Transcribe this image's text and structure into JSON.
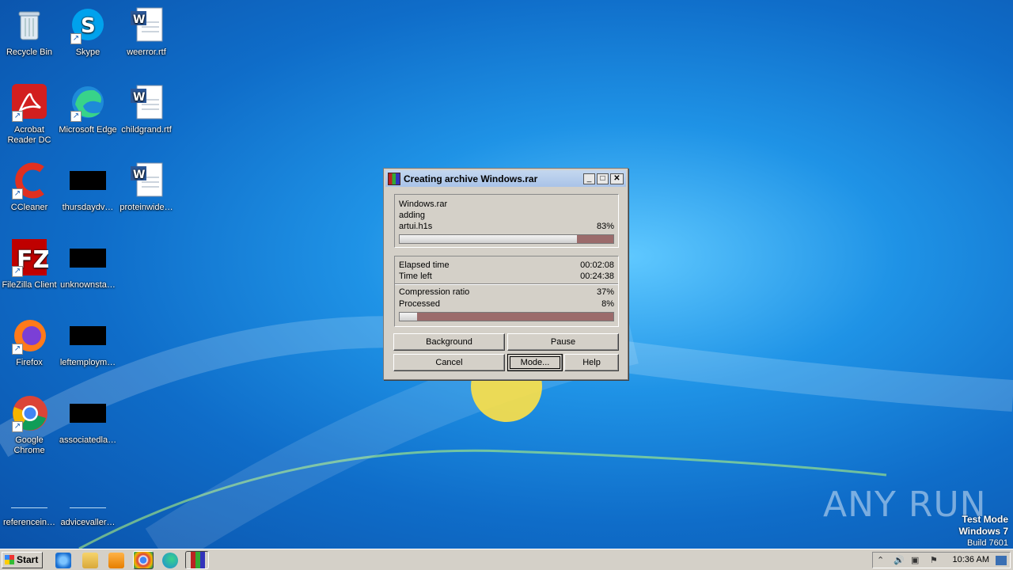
{
  "desktop": {
    "icons": [
      {
        "label": "Recycle Bin"
      },
      {
        "label": "Skype"
      },
      {
        "label": "weerror.rtf"
      },
      {
        "label": "Acrobat Reader DC"
      },
      {
        "label": "Microsoft Edge"
      },
      {
        "label": "childgrand.rtf"
      },
      {
        "label": "CCleaner"
      },
      {
        "label": "thursdaydv…"
      },
      {
        "label": "proteinwide…"
      },
      {
        "label": "FileZilla Client"
      },
      {
        "label": "unknownsta…"
      },
      {
        "label": "Firefox"
      },
      {
        "label": "leftemploym…"
      },
      {
        "label": "Google Chrome"
      },
      {
        "label": "associatedla…"
      },
      {
        "label": "referencein…"
      },
      {
        "label": "advicevaller…"
      }
    ]
  },
  "dialog": {
    "title": "Creating archive Windows.rar",
    "archive_name": "Windows.rar",
    "action": "adding",
    "current_file": "artui.h1s",
    "file_percent": "83%",
    "file_progress": 0.83,
    "elapsed_label": "Elapsed time",
    "elapsed_value": "00:02:08",
    "time_left_label": "Time left",
    "time_left_value": "00:24:38",
    "compression_label": "Compression ratio",
    "compression_value": "37%",
    "processed_label": "Processed",
    "processed_value": "8%",
    "processed_progress": 0.08,
    "buttons": {
      "background": "Background",
      "pause": "Pause",
      "cancel": "Cancel",
      "mode": "Mode...",
      "help": "Help"
    }
  },
  "watermark": "ANY RUN",
  "test_mode": {
    "line1": "Test Mode",
    "line2": "Windows 7",
    "line3": "Build 7601"
  },
  "taskbar": {
    "start_label": "Start",
    "clock": "10:36 AM"
  }
}
